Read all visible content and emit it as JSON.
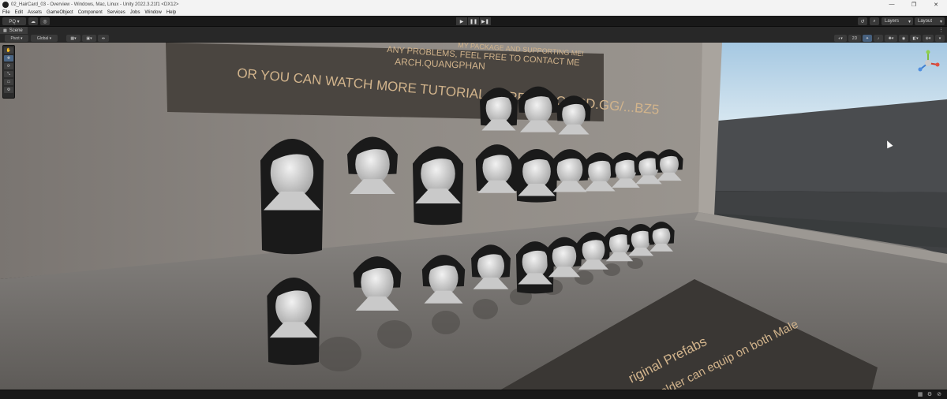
{
  "window": {
    "title": "02_HairCard_03 - Overview - Windows, Mac, Linux - Unity 2022.3.21f1 <DX12>",
    "controls": [
      "—",
      "❐",
      "✕"
    ]
  },
  "menu": [
    "File",
    "Edit",
    "Assets",
    "GameObject",
    "Component",
    "Services",
    "Jobs",
    "Window",
    "Help"
  ],
  "toolbar": {
    "account": "PQ ▾",
    "play": "▶",
    "pause": "❚❚",
    "step": "▶❚",
    "layers": "Layers",
    "layout": "Layout"
  },
  "scene_tab": {
    "label": "Scene",
    "kebab": "⋮"
  },
  "scene_toolbar": {
    "pivot": "Pivot ▾",
    "global": "Global ▾",
    "mode_2d": "2D"
  },
  "tools": [
    "✋",
    "✥",
    "⟳",
    "⤡",
    "▭",
    "⚙"
  ],
  "sign_lines": [
    "ANY PROBLEMS, FEEL FREE TO CONTACT ME",
    "ARCH.QUANGPHAN",
    "OR YOU CAN WATCH MORE TUTORIAL HERE: DISCORD.GG/...BZ5"
  ],
  "sign_top_fragment": "MY PACKAGE AND SUPPORTING ME!",
  "floor_sign": {
    "line1": "riginal Prefabs",
    "line2": "older can equip on both Male"
  },
  "colors": {
    "wall": "#8a8580",
    "floor": "#6f6c68",
    "sign": "#4a4540",
    "sign_text": "#d2b48c",
    "sky": "#b9d6ea",
    "hair": "#1a1a1a",
    "head": "#d8d8d8"
  }
}
